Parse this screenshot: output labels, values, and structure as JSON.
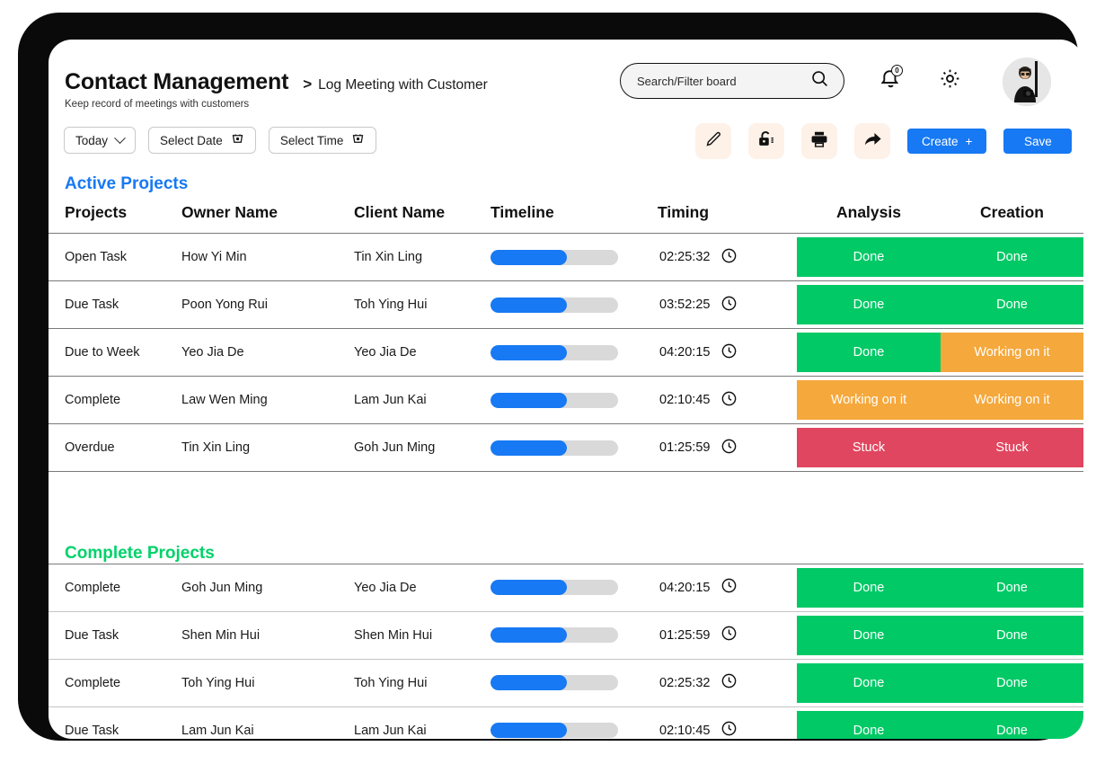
{
  "header": {
    "app_title": "Contact Management",
    "breadcrumb_separator": ">",
    "breadcrumb": "Log Meeting with Customer",
    "subtitle": "Keep record of meetings with customers",
    "notification_count": "0"
  },
  "filters": [
    {
      "label": "Today",
      "icon": "chevron-down-icon"
    },
    {
      "label": "Select Date",
      "icon": "calendar-icon"
    },
    {
      "label": "Select Time",
      "icon": "calendar-icon"
    }
  ],
  "search": {
    "placeholder": "Search/Filter board",
    "value": "",
    "icon": "search-icon"
  },
  "toolbar": {
    "icons": [
      "pencil-icon",
      "unlock-icon",
      "printer-icon",
      "share-arrow-icon"
    ],
    "create_label": "Create",
    "create_plus": "+",
    "save_label": "Save"
  },
  "colors": {
    "accent_blue": "#1779f3",
    "done_green": "#00c965",
    "working_orange": "#f5a83c",
    "stuck_red": "#e0465f",
    "section_active": "#1779f3",
    "section_complete": "#00d26a",
    "bar_track": "#d9d9d9",
    "tool_bg": "#fdf1e8"
  },
  "columns": [
    "Projects",
    "Owner Name",
    "Client Name",
    "Timeline",
    "Timing",
    "Analysis",
    "Creation"
  ],
  "sections": [
    {
      "title": "Active Projects",
      "color": "#1779f3",
      "rows": [
        {
          "project": "Open Task",
          "owner": "How Yi Min",
          "client": "Tin Xin Ling",
          "progress": 60,
          "timing": "02:25:32",
          "analysis": "Done",
          "analysis_state": "done",
          "creation": "Done",
          "creation_state": "done"
        },
        {
          "project": "Due Task",
          "owner": "Poon Yong Rui",
          "client": "Toh Ying Hui",
          "progress": 60,
          "timing": "03:52:25",
          "analysis": "Done",
          "analysis_state": "done",
          "creation": "Done",
          "creation_state": "done"
        },
        {
          "project": "Due to Week",
          "owner": "Yeo Jia De",
          "client": "Yeo Jia De",
          "progress": 60,
          "timing": "04:20:15",
          "analysis": "Done",
          "analysis_state": "done",
          "creation": "Working on it",
          "creation_state": "working"
        },
        {
          "project": "Complete",
          "owner": "Law Wen Ming",
          "client": "Lam Jun Kai",
          "progress": 60,
          "timing": "02:10:45",
          "analysis": "Working on it",
          "analysis_state": "working",
          "creation": "Working on it",
          "creation_state": "working"
        },
        {
          "project": "Overdue",
          "owner": "Tin Xin Ling",
          "client": "Goh Jun Ming",
          "progress": 60,
          "timing": "01:25:59",
          "analysis": "Stuck",
          "analysis_state": "stuck",
          "creation": "Stuck",
          "creation_state": "stuck"
        }
      ]
    },
    {
      "title": "Complete Projects",
      "color": "#00d26a",
      "rows": [
        {
          "project": "Complete",
          "owner": "Goh Jun Ming",
          "client": "Yeo Jia De",
          "progress": 60,
          "timing": "04:20:15",
          "analysis": "Done",
          "analysis_state": "done",
          "creation": "Done",
          "creation_state": "done"
        },
        {
          "project": "Due Task",
          "owner": "Shen Min Hui",
          "client": "Shen Min Hui",
          "progress": 60,
          "timing": "01:25:59",
          "analysis": "Done",
          "analysis_state": "done",
          "creation": "Done",
          "creation_state": "done"
        },
        {
          "project": "Complete",
          "owner": "Toh Ying Hui",
          "client": "Toh Ying Hui",
          "progress": 60,
          "timing": "02:25:32",
          "analysis": "Done",
          "analysis_state": "done",
          "creation": "Done",
          "creation_state": "done"
        },
        {
          "project": "Due Task",
          "owner": "Lam Jun Kai",
          "client": "Lam Jun Kai",
          "progress": 60,
          "timing": "02:10:45",
          "analysis": "Done",
          "analysis_state": "done",
          "creation": "Done",
          "creation_state": "done"
        }
      ]
    }
  ]
}
